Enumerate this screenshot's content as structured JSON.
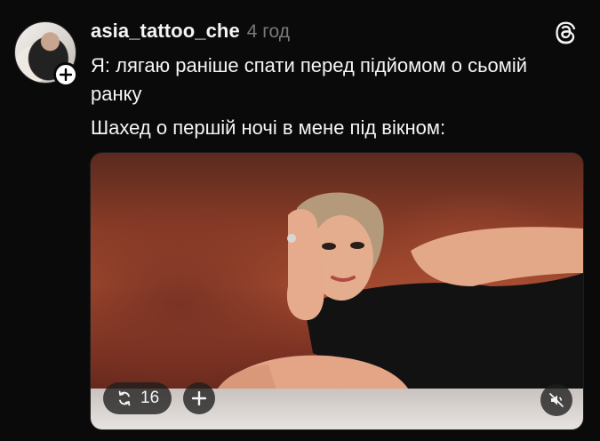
{
  "post": {
    "username": "asia_tattoo_che",
    "timestamp": "4 год",
    "text_line_1": "Я: лягаю раніше спати перед підйомом о сьомій ранку",
    "text_line_2": "Шахед о першій ночі в мене під вікном:"
  },
  "media": {
    "type": "video",
    "repost_count": "16",
    "muted": true
  },
  "icons": {
    "avatar_follow": "plus-icon",
    "app_logo": "threads-logo-icon",
    "repost": "repost-icon",
    "add": "plus-icon",
    "mute": "speaker-muted-icon"
  },
  "colors": {
    "background": "#0a0a0a",
    "text": "#f3f5f7",
    "muted_text": "#7a7a7a"
  }
}
